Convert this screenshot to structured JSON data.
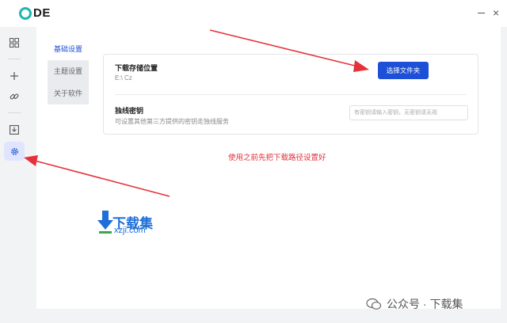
{
  "app": {
    "logo_text": "DE",
    "close_glyph": "×"
  },
  "sidebar": {
    "items": [
      {
        "icon": "grid-icon"
      },
      {
        "icon": "plus-icon"
      },
      {
        "icon": "link-icon"
      },
      {
        "icon": "download-icon"
      },
      {
        "icon": "gear-icon",
        "active": true
      }
    ]
  },
  "tabs": [
    {
      "label": "基础设置",
      "active": true
    },
    {
      "label": "主题设置"
    },
    {
      "label": "关于软件"
    }
  ],
  "settings": {
    "download_location": {
      "title": "下载存储位置",
      "path": "E:\\ Cz",
      "button": "选择文件夹"
    },
    "exclusive_key": {
      "title": "独线密钥",
      "desc": "可设置其他第三方提供的密钥走独线服务",
      "placeholder": "有密钥请输入密钥，无密钥请无视"
    }
  },
  "notice": "使用之前先把下载路径设置好",
  "watermark": {
    "name": "下载集",
    "url": "xzji.com"
  },
  "footer": {
    "wechat": "公众号 · 下载集"
  },
  "colors": {
    "accent": "#1d4fd7",
    "logo": "#1fb6b0",
    "notice": "#e0303a",
    "arrow": "#e5323a"
  }
}
